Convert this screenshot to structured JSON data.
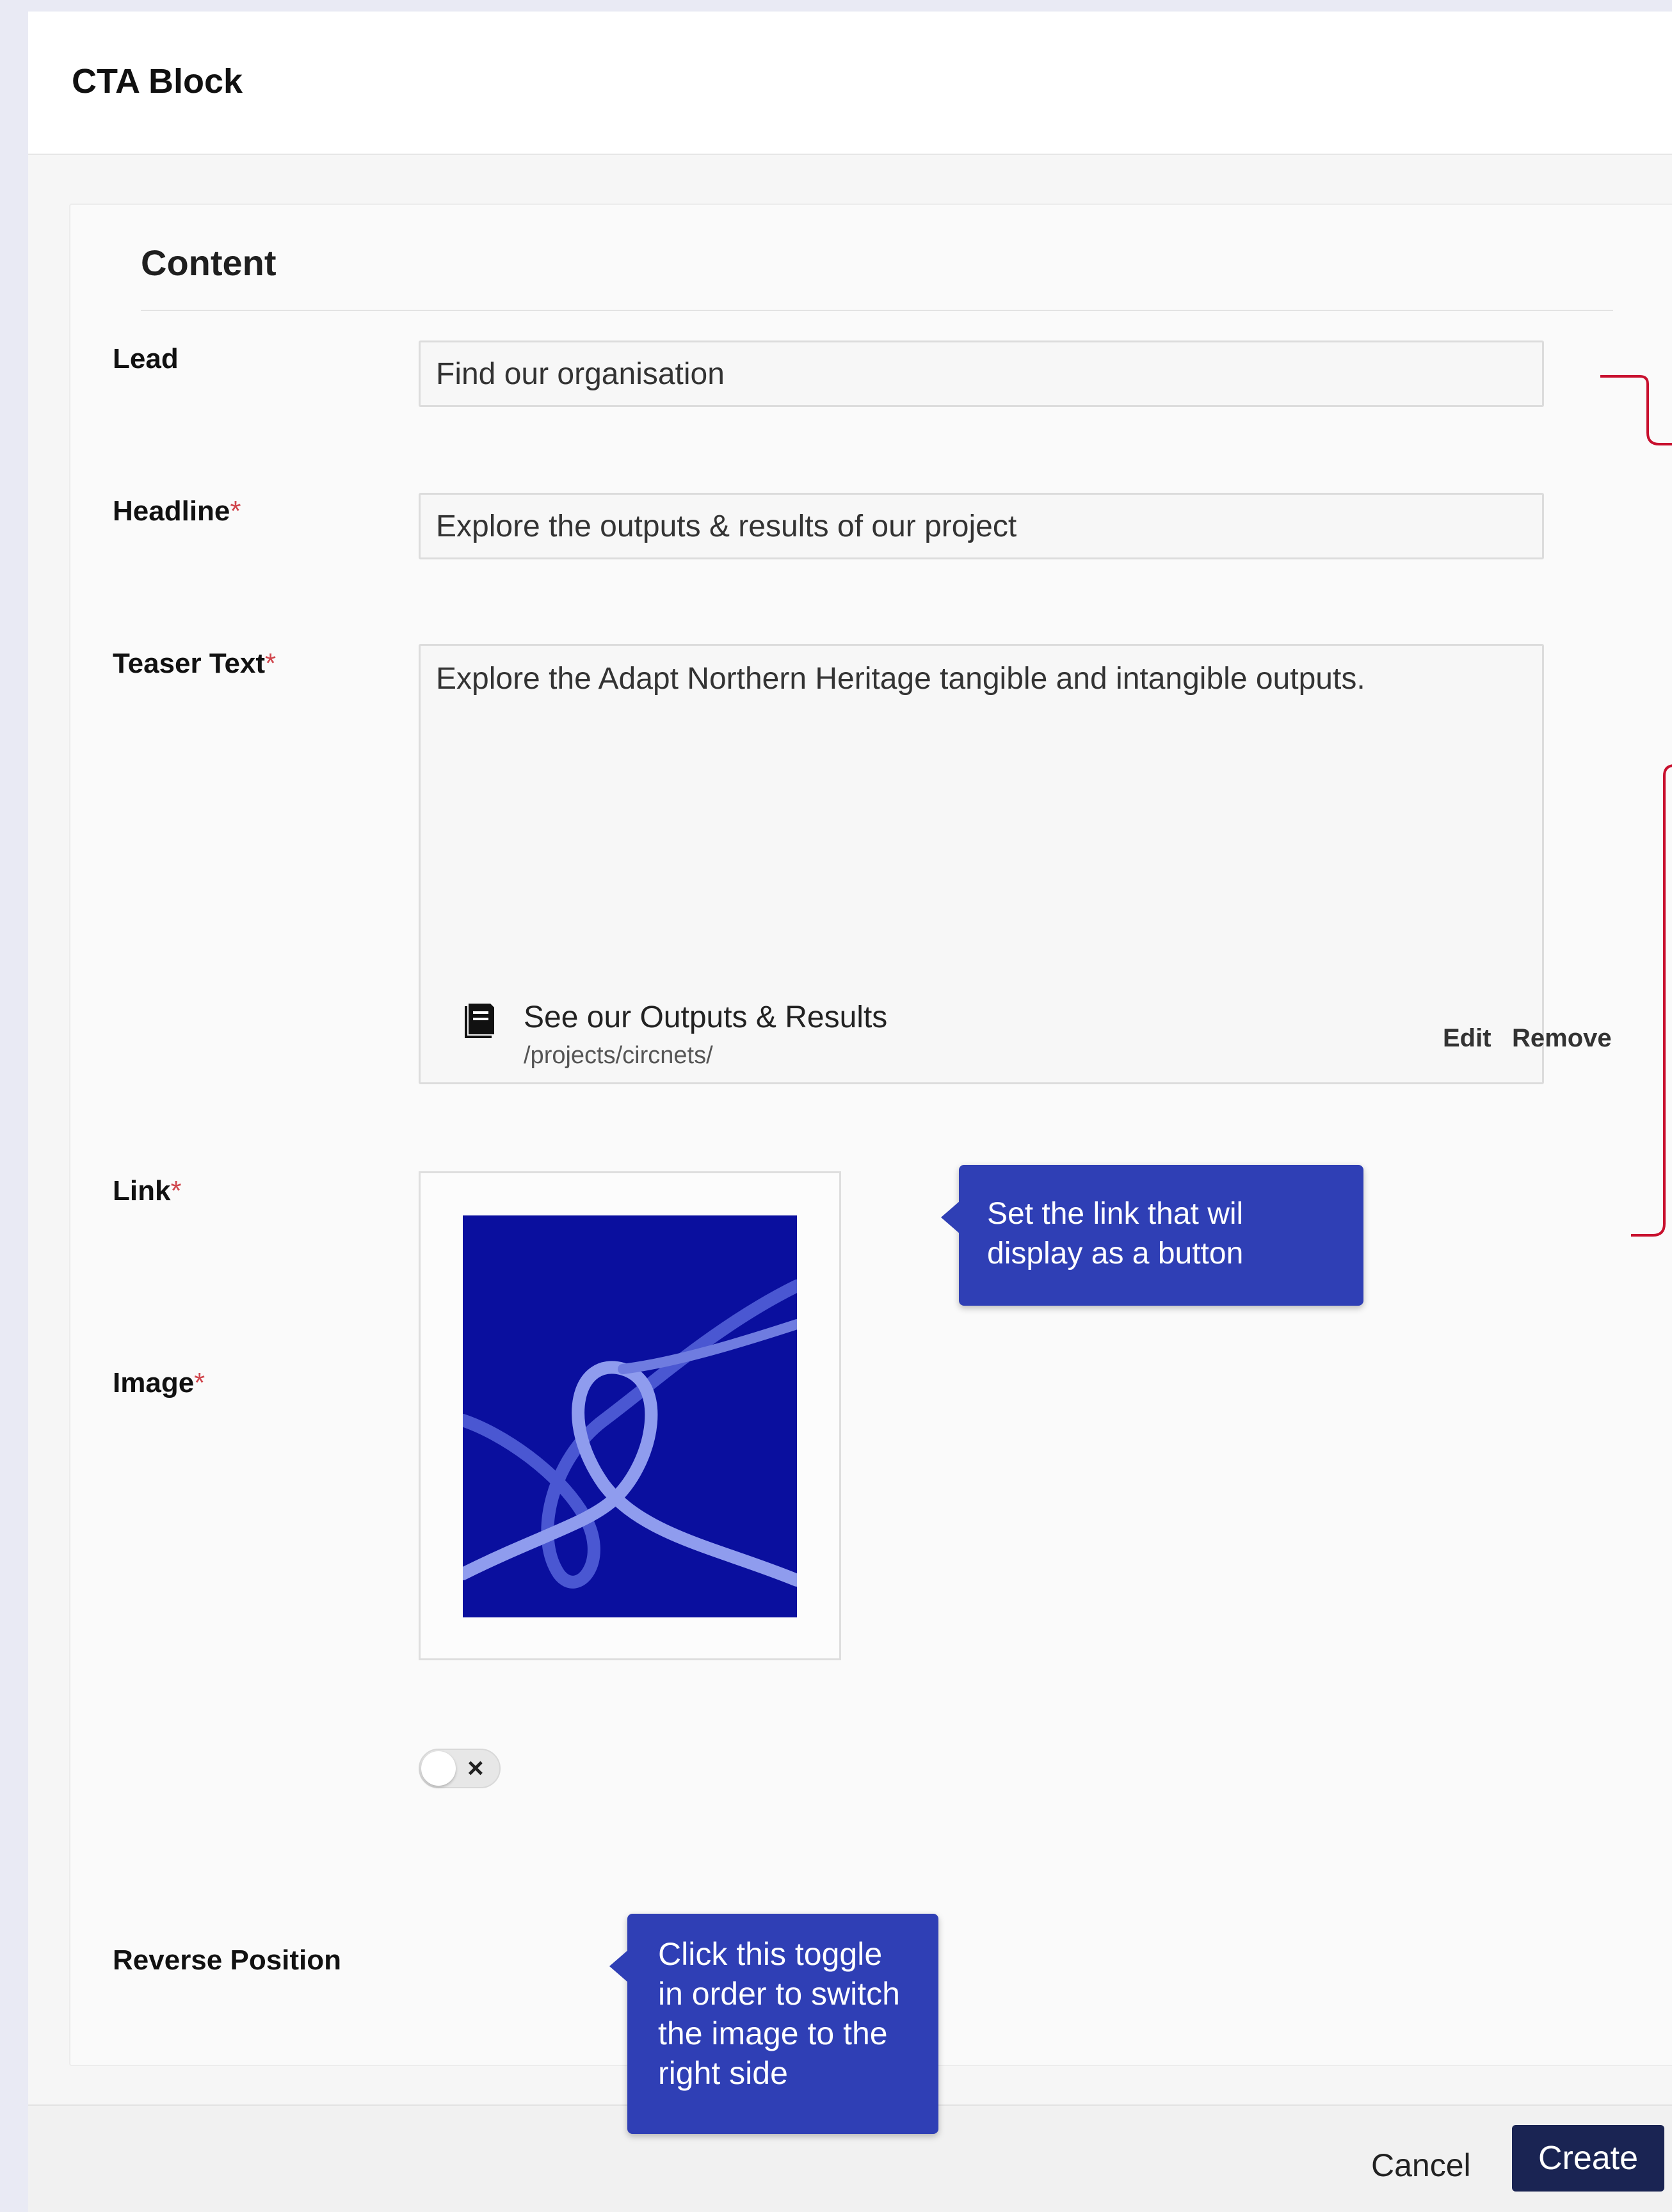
{
  "dialog": {
    "title": "CTA Block"
  },
  "section": {
    "title": "Content"
  },
  "fields": {
    "lead": {
      "label": "Lead",
      "value": "Find our organisation"
    },
    "headline": {
      "label": "Headline",
      "required": "*",
      "value": "Explore the outputs & results of our project"
    },
    "teaser": {
      "label": "Teaser Text",
      "required": "*",
      "value": "Explore the Adapt Northern Heritage tangible and intangible outputs."
    },
    "link": {
      "label": "Link",
      "required": "*",
      "title": "See our Outputs & Results",
      "url": "/projects/circnets/",
      "edit_label": "Edit",
      "remove_label": "Remove",
      "icon": "document-icon"
    },
    "image": {
      "label": "Image",
      "required": "*"
    },
    "reverse": {
      "label": "Reverse Position",
      "toggle_symbol": "×",
      "checked": false
    }
  },
  "tooltips": {
    "link": "Set the link that wil display as a button",
    "toggle": "Click this toggle in order to switch the image to the right side"
  },
  "footer": {
    "cancel_label": "Cancel",
    "create_label": "Create"
  },
  "colors": {
    "tooltip": "#2f3fb5",
    "primary_button": "#1a2453",
    "annotation_line": "#c8102e",
    "required_marker": "#d0454c",
    "image_background": "#0a0f9e"
  }
}
